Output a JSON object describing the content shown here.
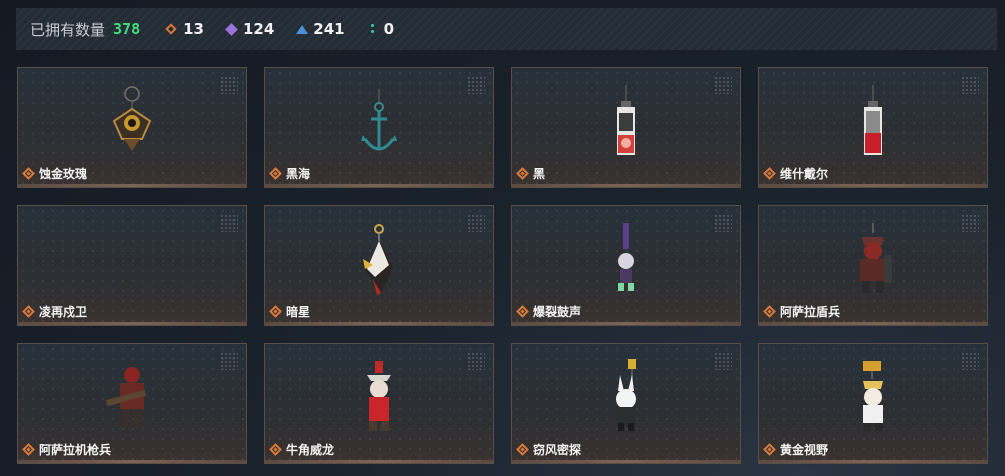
{
  "summary": {
    "owned_label": "已拥有数量",
    "owned_count": "378",
    "stats": [
      {
        "icon": "orange-diamond-icon",
        "value": "13",
        "color": "#d97a3a"
      },
      {
        "icon": "purple-diamond-icon",
        "value": "124",
        "color": "#9a72d8"
      },
      {
        "icon": "blue-triangle-icon",
        "value": "241",
        "color": "#4a8fd8"
      },
      {
        "icon": "teal-dots-icon",
        "value": "0",
        "color": "#36c9b0"
      }
    ]
  },
  "items": [
    {
      "name": "蚀金玫瑰",
      "rarity_icon": "orange-diamond-icon"
    },
    {
      "name": "黑海",
      "rarity_icon": "orange-diamond-icon"
    },
    {
      "name": "黑",
      "rarity_icon": "orange-diamond-icon"
    },
    {
      "name": "维什戴尔",
      "rarity_icon": "orange-diamond-icon"
    },
    {
      "name": "凌再戍卫",
      "rarity_icon": "orange-diamond-icon"
    },
    {
      "name": "暗星",
      "rarity_icon": "orange-diamond-icon"
    },
    {
      "name": "爆裂鼓声",
      "rarity_icon": "orange-diamond-icon"
    },
    {
      "name": "阿萨拉盾兵",
      "rarity_icon": "orange-diamond-icon"
    },
    {
      "name": "阿萨拉机枪兵",
      "rarity_icon": "orange-diamond-icon"
    },
    {
      "name": "牛角威龙",
      "rarity_icon": "orange-diamond-icon"
    },
    {
      "name": "窃风密探",
      "rarity_icon": "orange-diamond-icon"
    },
    {
      "name": "黄金视野",
      "rarity_icon": "orange-diamond-icon"
    }
  ]
}
